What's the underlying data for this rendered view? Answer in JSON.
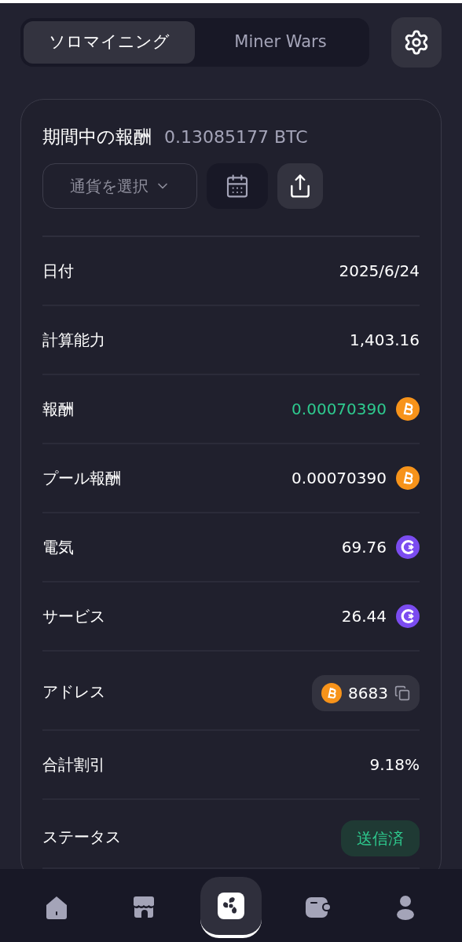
{
  "tabs": [
    {
      "label": "ソロマイニング",
      "selected": true
    },
    {
      "label": "Miner Wars",
      "selected": false
    }
  ],
  "rewards": {
    "title": "期間中の報酬",
    "total": "0.13085177 BTC",
    "currency_select": {
      "placeholder": "通貨を選択"
    },
    "rows": [
      {
        "kind": "text",
        "label": "日付",
        "value": "2025/6/24"
      },
      {
        "kind": "text",
        "label": "計算能力",
        "value": "1,403.16"
      },
      {
        "kind": "btc",
        "label": "報酬",
        "value": "0.00070390",
        "highlight": true
      },
      {
        "kind": "btc",
        "label": "プール報酬",
        "value": "0.00070390",
        "highlight": false
      },
      {
        "kind": "token",
        "label": "電気",
        "value": "69.76",
        "highlight": false
      },
      {
        "kind": "token",
        "label": "サービス",
        "value": "26.44",
        "highlight": false
      },
      {
        "kind": "address",
        "label": "アドレス",
        "value": "8683"
      },
      {
        "kind": "text",
        "label": "合計割引",
        "value": "9.18%"
      },
      {
        "kind": "status",
        "label": "ステータス",
        "value": "送信済"
      }
    ]
  },
  "nav": [
    {
      "selected": false
    },
    {
      "selected": false
    },
    {
      "selected": true
    },
    {
      "selected": false
    },
    {
      "selected": false
    }
  ]
}
